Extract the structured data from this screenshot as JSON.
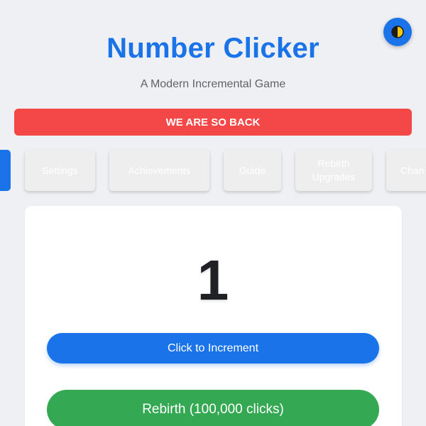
{
  "header": {
    "title": "Number Clicker",
    "subtitle": "A Modern Incremental Game",
    "theme_toggle_icon": "half-moon-icon"
  },
  "banner": {
    "text": "WE ARE SO BACK",
    "color": "#f44747"
  },
  "tabs": [
    {
      "label": "",
      "active": true
    },
    {
      "label": "Settings",
      "active": false
    },
    {
      "label": "Achievements",
      "active": false
    },
    {
      "label": "Guide",
      "active": false
    },
    {
      "label_line1": "Rebirth",
      "label_line2": "Upgrades",
      "active": false
    },
    {
      "label": "Chan",
      "active": false
    }
  ],
  "game": {
    "counter": "1",
    "increment_button_label": "Click to Increment",
    "rebirth_button_label": "Rebirth (100,000 clicks)"
  },
  "colors": {
    "accent": "#1a73e8",
    "success": "#34a853",
    "background": "#eef0f4"
  }
}
